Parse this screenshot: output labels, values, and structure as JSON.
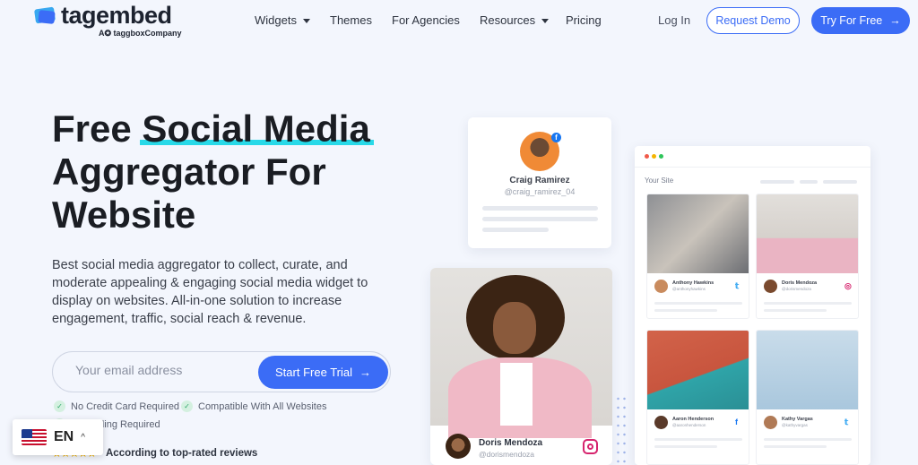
{
  "nav": {
    "logo_text": "tagembed",
    "logo_sub": "A✪ taggboxCompany",
    "items": [
      {
        "label": "Widgets",
        "dropdown": true
      },
      {
        "label": "Themes",
        "dropdown": false
      },
      {
        "label": "For Agencies",
        "dropdown": false
      },
      {
        "label": "Resources",
        "dropdown": true
      },
      {
        "label": "Pricing",
        "dropdown": false
      }
    ],
    "login": "Log In",
    "request_demo": "Request Demo",
    "try_free": "Try For Free"
  },
  "hero": {
    "title_pre": "Free ",
    "title_highlight": "Social Media",
    "title_post": "Aggregator For Website",
    "description": "Best social media aggregator to collect, curate, and moderate appealing & engaging social media widget to display on websites. All-in-one solution to increase engagement, traffic, social reach & revenue.",
    "email_placeholder": "Your email address",
    "cta": "Start Free Trial",
    "checks": [
      "No Credit Card Required",
      "Compatible With All Websites",
      "No Coding Required"
    ],
    "stars": "★★★★★",
    "reviews": "According to top-rated reviews"
  },
  "language": {
    "code": "EN",
    "caret": "^"
  },
  "profile_card": {
    "name": "Craig Ramirez",
    "handle": "@craig_ramirez_04"
  },
  "photo_card": {
    "name": "Doris Mendoza",
    "handle": "@dorismendoza"
  },
  "site_window": {
    "label": "Your Site",
    "tiles": [
      {
        "name": "Anthony Hawkins",
        "handle": "@anthonyhawkins",
        "network": "twitter"
      },
      {
        "name": "Doris Mendoza",
        "handle": "@dorismendoza",
        "network": "instagram"
      },
      {
        "name": "Aaron Henderson",
        "handle": "@aaronhenderson",
        "network": "facebook"
      },
      {
        "name": "Kathy Vargas",
        "handle": "@kathyvargas",
        "network": "twitter"
      }
    ]
  },
  "colors": {
    "accent": "#3b6cf6",
    "highlight": "#28d9e8",
    "background": "#f3f6fd"
  }
}
